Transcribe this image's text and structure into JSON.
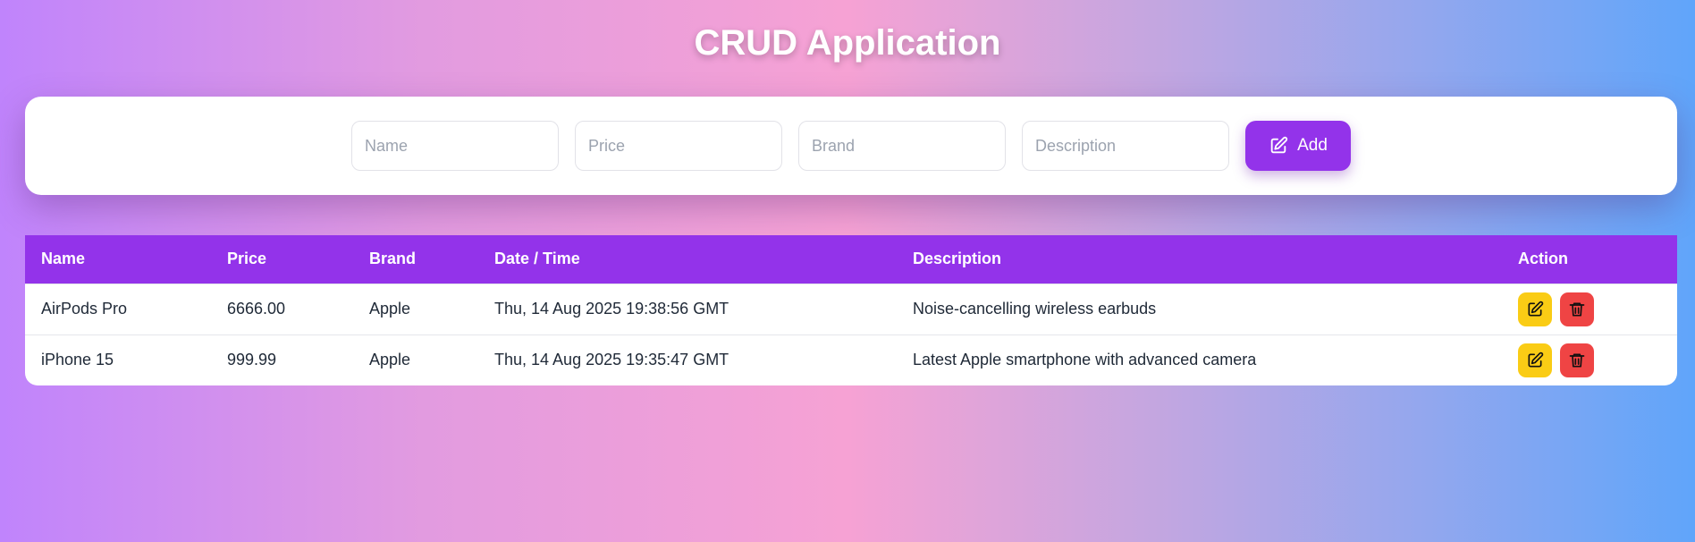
{
  "app": {
    "title": "CRUD Application"
  },
  "form": {
    "name_placeholder": "Name",
    "price_placeholder": "Price",
    "brand_placeholder": "Brand",
    "description_placeholder": "Description",
    "add_label": "Add",
    "add_icon": "pencil-square-icon"
  },
  "table": {
    "headers": [
      "Name",
      "Price",
      "Brand",
      "Date / Time",
      "Description",
      "Action"
    ],
    "rows": [
      {
        "name": "AirPods Pro",
        "price": "6666.00",
        "brand": "Apple",
        "datetime": "Thu, 14 Aug 2025 19:38:56 GMT",
        "description": "Noise-cancelling wireless earbuds"
      },
      {
        "name": "iPhone 15",
        "price": "999.99",
        "brand": "Apple",
        "datetime": "Thu, 14 Aug 2025 19:35:47 GMT",
        "description": "Latest Apple smartphone with advanced camera"
      }
    ],
    "edit_icon": "edit-icon",
    "delete_icon": "trash-icon"
  },
  "colors": {
    "accent": "#9333ea",
    "edit": "#facc15",
    "delete": "#ef4444"
  }
}
